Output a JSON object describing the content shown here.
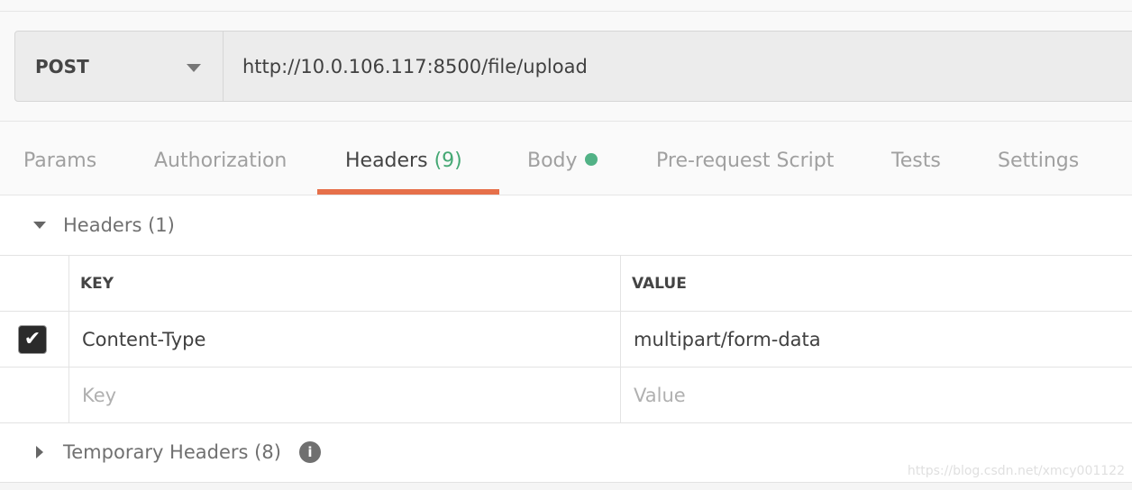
{
  "request": {
    "method": "POST",
    "url": "http://10.0.106.117:8500/file/upload"
  },
  "tabs": [
    {
      "label": "Params"
    },
    {
      "label": "Authorization"
    },
    {
      "label": "Headers",
      "count": "(9)",
      "active": true
    },
    {
      "label": "Body",
      "indicator": "green-dot"
    },
    {
      "label": "Pre-request Script"
    },
    {
      "label": "Tests"
    },
    {
      "label": "Settings"
    }
  ],
  "headers_section": {
    "title": "Headers",
    "count": "(1)"
  },
  "table": {
    "columns": [
      "KEY",
      "VALUE"
    ],
    "rows": [
      {
        "checked": true,
        "key": "Content-Type",
        "value": "multipart/form-data"
      }
    ],
    "placeholder": {
      "key": "Key",
      "value": "Value"
    }
  },
  "temp_section": {
    "title": "Temporary Headers",
    "count": "(8)",
    "info_icon": "i"
  },
  "watermark": "https://blog.csdn.net/xmcy001122",
  "colors": {
    "accent": "#e6704a",
    "count": "#45a874",
    "dot": "#52b286"
  }
}
